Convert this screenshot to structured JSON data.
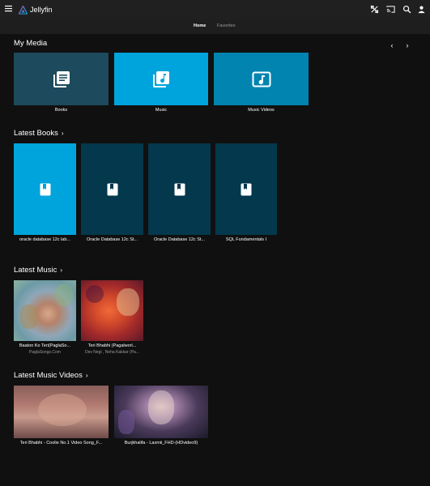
{
  "header": {
    "brand": "Jellyfin",
    "icons": [
      "menu-icon",
      "cast-icon",
      "search-icon",
      "user-icon"
    ]
  },
  "tabs": [
    {
      "label": "Home",
      "active": true
    },
    {
      "label": "Favorites",
      "active": false
    }
  ],
  "sections": {
    "my_media": {
      "title": "My Media",
      "items": [
        {
          "label": "Books",
          "color": "#1d4a5c",
          "icon": "library-books-icon"
        },
        {
          "label": "Music",
          "color": "#00a4dc",
          "icon": "library-music-icon"
        },
        {
          "label": "Music Videos",
          "color": "#0284b0",
          "icon": "music-video-icon"
        }
      ]
    },
    "latest_books": {
      "title": "Latest Books",
      "items": [
        {
          "label": "oracle database 12c lab...",
          "color": "#00a4dc"
        },
        {
          "label": "Oracle Database 12c St...",
          "color": "#03384d"
        },
        {
          "label": "Oracle Database 12c St...",
          "color": "#03384d"
        },
        {
          "label": "SQL Fundamentals I",
          "color": "#03384d"
        }
      ]
    },
    "latest_music": {
      "title": "Latest Music",
      "items": [
        {
          "label": "Baaton Ko Teri(PaglaSo...",
          "sub": "PaglaSongs.Com"
        },
        {
          "label": "Teri Bhabhi (Pagalworl...",
          "sub": "Dev Negi , Neha Kakkar (Pa..."
        }
      ]
    },
    "latest_music_videos": {
      "title": "Latest Music Videos",
      "items": [
        {
          "label": "Teri Bhabhi - Coolie No.1 Video Song_F..."
        },
        {
          "label": "Burjkhalifa - Laxmii_FHD-(HDvideo9)"
        }
      ]
    }
  }
}
